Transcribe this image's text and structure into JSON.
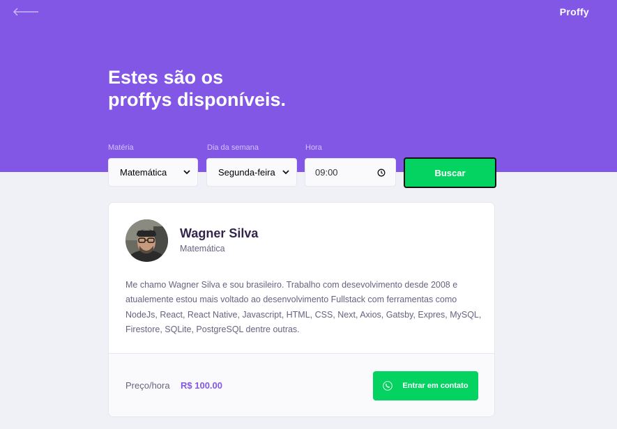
{
  "header": {
    "logo": "Proffy",
    "title_line1": "Estes são os",
    "title_line2": "proffys disponíveis."
  },
  "filters": {
    "subject_label": "Matéria",
    "subject_value": "Matemática",
    "weekday_label": "Dia da semana",
    "weekday_value": "Segunda-feira",
    "time_label": "Hora",
    "time_value": "09:00",
    "search_button": "Buscar"
  },
  "teacher": {
    "name": "Wagner Silva",
    "subject": "Matemática",
    "bio": "Me chamo Wagner Silva e sou brasileiro. Trabalho com desevolvimento desde 2008 e atualemente estou mais voltado ao desenvolvimento Fullstack com ferramentas como NodeJs, React, React Native, Javascript, HTML, CSS, Next, Axios, Gatsby, Expres, MySQL, Firestore, SQLite, PostgreSQL dentre outras.",
    "price_label": "Preço/hora",
    "price_value": "R$ 100.00",
    "contact_button": "Entrar em contato"
  },
  "colors": {
    "primary": "#8257e5",
    "secondary": "#04d361",
    "background": "#f0f0f7"
  },
  "icons": {
    "back": "arrow-left-icon",
    "dropdown": "chevron-down-icon",
    "clock": "clock-icon",
    "contact": "whatsapp-icon"
  }
}
